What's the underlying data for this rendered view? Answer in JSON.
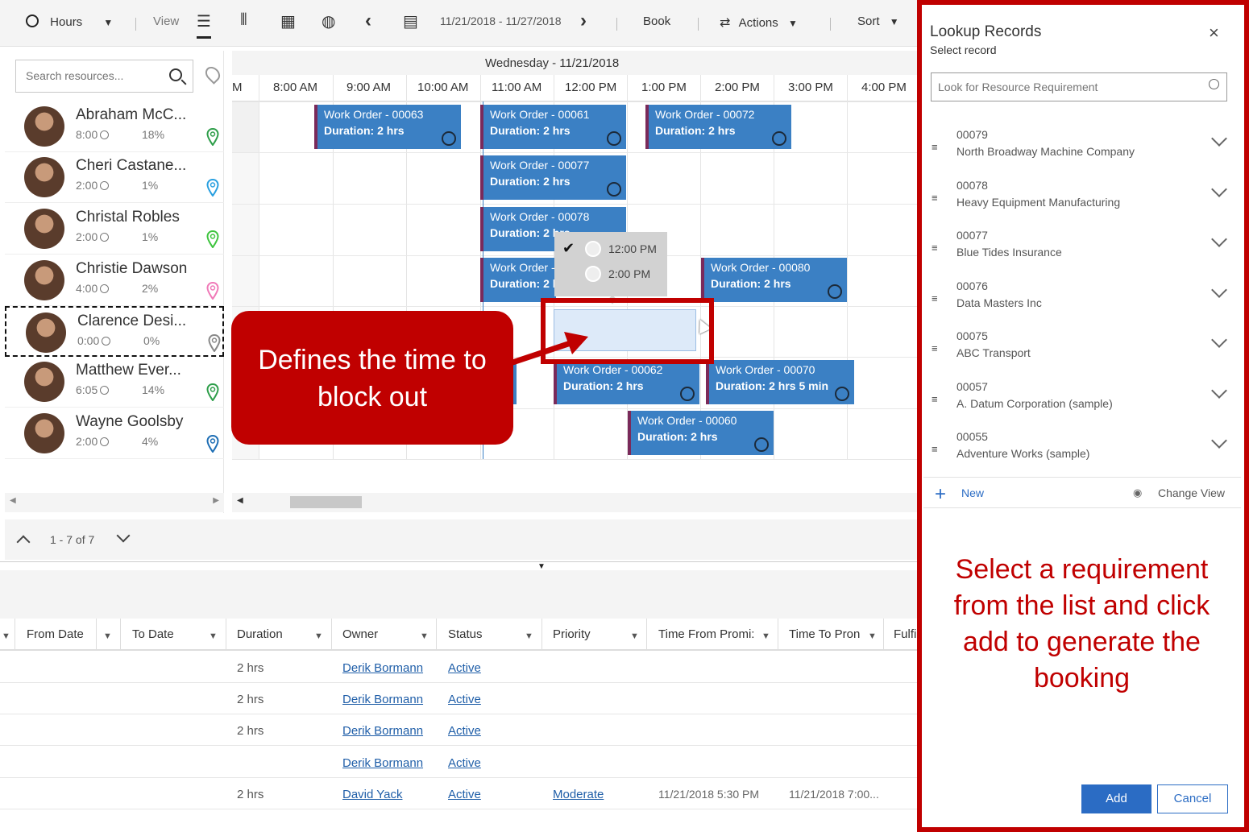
{
  "toolbar": {
    "hours": "Hours",
    "view": "View",
    "date_range": "11/21/2018 - 11/27/2018",
    "book": "Book",
    "actions": "Actions",
    "sort": "Sort"
  },
  "resources": {
    "search_placeholder": "Search resources...",
    "items": [
      {
        "name": "Abraham McC...",
        "hours": "8:00",
        "pct": "18%",
        "pin_color": "#2e9e4a"
      },
      {
        "name": "Cheri Castane...",
        "hours": "2:00",
        "pct": "1%",
        "pin_color": "#2aa0e0"
      },
      {
        "name": "Christal Robles",
        "hours": "2:00",
        "pct": "1%",
        "pin_color": "#3ec43e"
      },
      {
        "name": "Christie Dawson",
        "hours": "4:00",
        "pct": "2%",
        "pin_color": "#f07ab8"
      },
      {
        "name": "Clarence Desi...",
        "hours": "0:00",
        "pct": "0%",
        "pin_color": "#888888"
      },
      {
        "name": "Matthew Ever...",
        "hours": "6:05",
        "pct": "14%",
        "pin_color": "#2e9e4a"
      },
      {
        "name": "Wayne Goolsby",
        "hours": "2:00",
        "pct": "4%",
        "pin_color": "#1f6fb5"
      }
    ],
    "pager": "1 - 7 of 7"
  },
  "schedule": {
    "date": "Wednesday - 11/21/2018",
    "hours": [
      "M",
      "8:00 AM",
      "9:00 AM",
      "10:00 AM",
      "11:00 AM",
      "12:00 PM",
      "1:00 PM",
      "2:00 PM",
      "3:00 PM",
      "4:00 PM"
    ],
    "work_orders": [
      {
        "title": "Work Order - 00063",
        "duration": "Duration: 2 hrs"
      },
      {
        "title": "Work Order - 00061",
        "duration": "Duration: 2 hrs"
      },
      {
        "title": "Work Order - 00072",
        "duration": "Duration: 2 hrs"
      },
      {
        "title": "Work Order - 00077",
        "duration": "Duration: 2 hrs"
      },
      {
        "title": "Work Order - 00078",
        "duration": "Duration: 2 hrs"
      },
      {
        "title": "Work Order -",
        "duration": "Duration: 2 h"
      },
      {
        "title": "Work Order - 00080",
        "duration": "Duration: 2 hrs"
      },
      {
        "title": "Work Order - 00062",
        "duration": "Duration: 2 hrs"
      },
      {
        "title": "Work Order - 00070",
        "duration": "Duration: 2 hrs 5 min"
      },
      {
        "title": "Work Order - 00060",
        "duration": "Duration: 2 hrs"
      }
    ],
    "time_popup": [
      "12:00 PM",
      "2:00 PM"
    ]
  },
  "callout": "Defines the time to block out",
  "grid": {
    "columns": [
      "From Date",
      "To Date",
      "Duration",
      "Owner",
      "Status",
      "Priority",
      "Time From Promi:",
      "Time To Pron",
      "Fulfi"
    ],
    "rows": [
      {
        "duration": "2 hrs",
        "owner": "Derik Bormann",
        "status": "Active",
        "priority": "",
        "from_promised": "",
        "to_promised": ""
      },
      {
        "duration": "2 hrs",
        "owner": "Derik Bormann",
        "status": "Active",
        "priority": "",
        "from_promised": "",
        "to_promised": ""
      },
      {
        "duration": "2 hrs",
        "owner": "Derik Bormann",
        "status": "Active",
        "priority": "",
        "from_promised": "",
        "to_promised": ""
      },
      {
        "duration": "",
        "owner": "Derik Bormann",
        "status": "Active",
        "priority": "",
        "from_promised": "",
        "to_promised": ""
      },
      {
        "duration": "2 hrs",
        "owner": "David Yack",
        "status": "Active",
        "priority": "Moderate",
        "from_promised": "11/21/2018 5:30 PM",
        "to_promised": "11/21/2018 7:00..."
      }
    ]
  },
  "lookup": {
    "title": "Lookup Records",
    "subtitle": "Select record",
    "search_placeholder": "Look for Resource Requirement",
    "items": [
      {
        "id": "00079",
        "name": "North Broadway Machine Company"
      },
      {
        "id": "00078",
        "name": "Heavy Equipment Manufacturing"
      },
      {
        "id": "00077",
        "name": "Blue Tides Insurance"
      },
      {
        "id": "00076",
        "name": "Data Masters Inc"
      },
      {
        "id": "00075",
        "name": "ABC Transport"
      },
      {
        "id": "00057",
        "name": "A. Datum Corporation (sample)"
      },
      {
        "id": "00055",
        "name": "Adventure Works (sample)"
      }
    ],
    "new_label": "New",
    "change_view": "Change View",
    "note": "Select a requirement from the list and click add to generate the booking",
    "add": "Add",
    "cancel": "Cancel"
  }
}
